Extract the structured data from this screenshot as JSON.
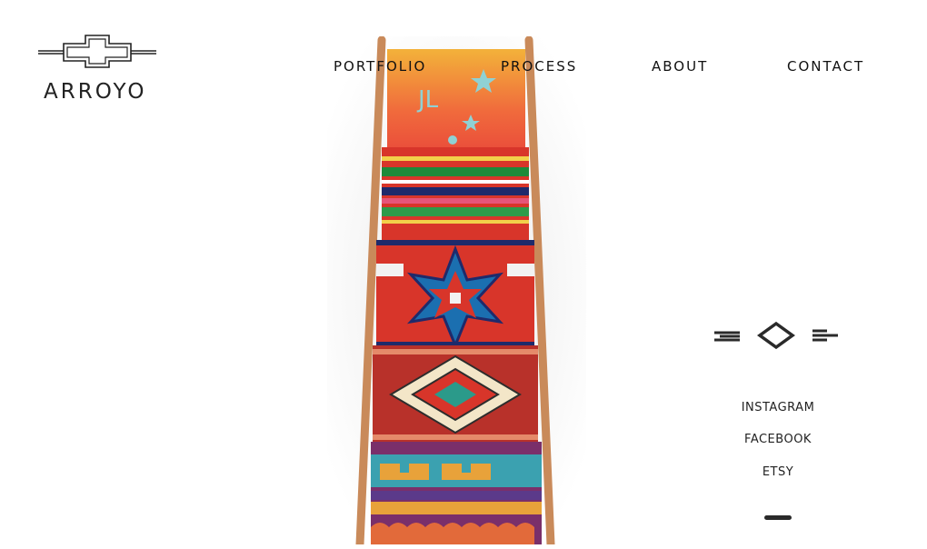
{
  "brand": {
    "name": "ARROYO"
  },
  "nav": {
    "items": [
      {
        "label": "PORTFOLIO"
      },
      {
        "label": "PROCESS"
      },
      {
        "label": "ABOUT"
      },
      {
        "label": "CONTACT"
      }
    ]
  },
  "hero": {
    "description": "blanket-ladder-photo"
  },
  "social": {
    "links": [
      {
        "label": "INSTAGRAM"
      },
      {
        "label": "FACEBOOK"
      },
      {
        "label": "ETSY"
      }
    ]
  },
  "colors": {
    "text": "#111111",
    "accent_red": "#d8352a",
    "wood": "#c98a5a"
  }
}
